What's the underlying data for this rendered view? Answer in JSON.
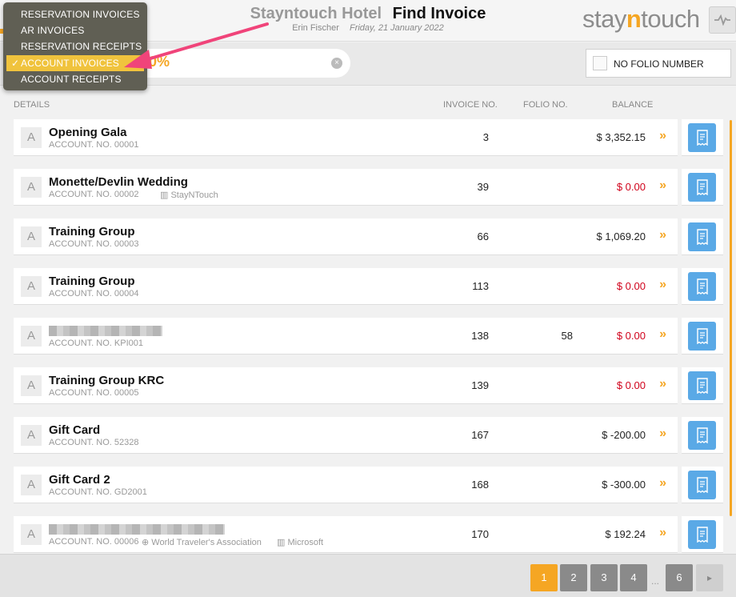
{
  "header": {
    "hotel_name": "Stayntouch Hotel",
    "page_title": "Find Invoice",
    "user": "Erin Fischer",
    "date": "Friday, 21 January 2022",
    "logo_prefix": "stay",
    "logo_highlight": "n",
    "logo_suffix": "touch"
  },
  "search": {
    "value_visible": "0%"
  },
  "filters": {
    "no_folio_label": "NO FOLIO NUMBER"
  },
  "dropdown": {
    "items": [
      {
        "label": "RESERVATION INVOICES",
        "selected": false
      },
      {
        "label": "AR INVOICES",
        "selected": false
      },
      {
        "label": "RESERVATION RECEIPTS",
        "selected": false
      },
      {
        "label": "ACCOUNT INVOICES",
        "selected": true
      },
      {
        "label": "ACCOUNT RECEIPTS",
        "selected": false
      }
    ],
    "check_mark": "✓"
  },
  "columns": {
    "details": "DETAILS",
    "invoice_no": "INVOICE NO.",
    "folio_no": "FOLIO NO.",
    "balance": "BALANCE"
  },
  "rows": [
    {
      "badge": "A",
      "name": "Opening Gala",
      "account": "ACCOUNT. NO. 00001",
      "company": "",
      "travel_agent": "",
      "invoice": "3",
      "folio": "",
      "balance": "$ 3,352.15",
      "zero": false
    },
    {
      "badge": "A",
      "name": "Monette/Devlin Wedding",
      "account": "ACCOUNT. NO. 00002",
      "company": "StayNTouch",
      "travel_agent": "",
      "invoice": "39",
      "folio": "",
      "balance": "$ 0.00",
      "zero": true
    },
    {
      "badge": "A",
      "name": "Training Group",
      "account": "ACCOUNT. NO. 00003",
      "company": "",
      "travel_agent": "",
      "invoice": "66",
      "folio": "",
      "balance": "$ 1,069.20",
      "zero": false
    },
    {
      "badge": "A",
      "name": "Training Group",
      "account": "ACCOUNT. NO. 00004",
      "company": "",
      "travel_agent": "",
      "invoice": "113",
      "folio": "",
      "balance": "$ 0.00",
      "zero": true
    },
    {
      "badge": "A",
      "name": "",
      "account": "ACCOUNT. NO. KPI001",
      "company": "",
      "travel_agent": "",
      "invoice": "138",
      "folio": "58",
      "balance": "$ 0.00",
      "zero": true
    },
    {
      "badge": "A",
      "name": "Training Group KRC",
      "account": "ACCOUNT. NO. 00005",
      "company": "",
      "travel_agent": "",
      "invoice": "139",
      "folio": "",
      "balance": "$ 0.00",
      "zero": true
    },
    {
      "badge": "A",
      "name": "Gift Card",
      "account": "ACCOUNT. NO. 52328",
      "company": "",
      "travel_agent": "",
      "invoice": "167",
      "folio": "",
      "balance": "$ -200.00",
      "zero": false
    },
    {
      "badge": "A",
      "name": "Gift Card 2",
      "account": "ACCOUNT. NO. GD2001",
      "company": "",
      "travel_agent": "",
      "invoice": "168",
      "folio": "",
      "balance": "$ -300.00",
      "zero": false
    },
    {
      "badge": "A",
      "name": "",
      "account": "ACCOUNT. NO. 00006",
      "company": "Microsoft",
      "travel_agent": "World Traveler's Association",
      "invoice": "170",
      "folio": "",
      "balance": "$ 192.24",
      "zero": false
    }
  ],
  "pagination": {
    "pages": [
      "1",
      "2",
      "3",
      "4",
      "6"
    ],
    "active": "1",
    "ellipsis": "...",
    "next": "▸"
  },
  "colors": {
    "accent": "#f5a623",
    "negative_zero": "#d0021b",
    "receipt_button": "#5aa9e6",
    "dropdown_bg": "#605f54",
    "dropdown_selected": "#f0c33d",
    "annotation_arrow": "#f0447a"
  }
}
